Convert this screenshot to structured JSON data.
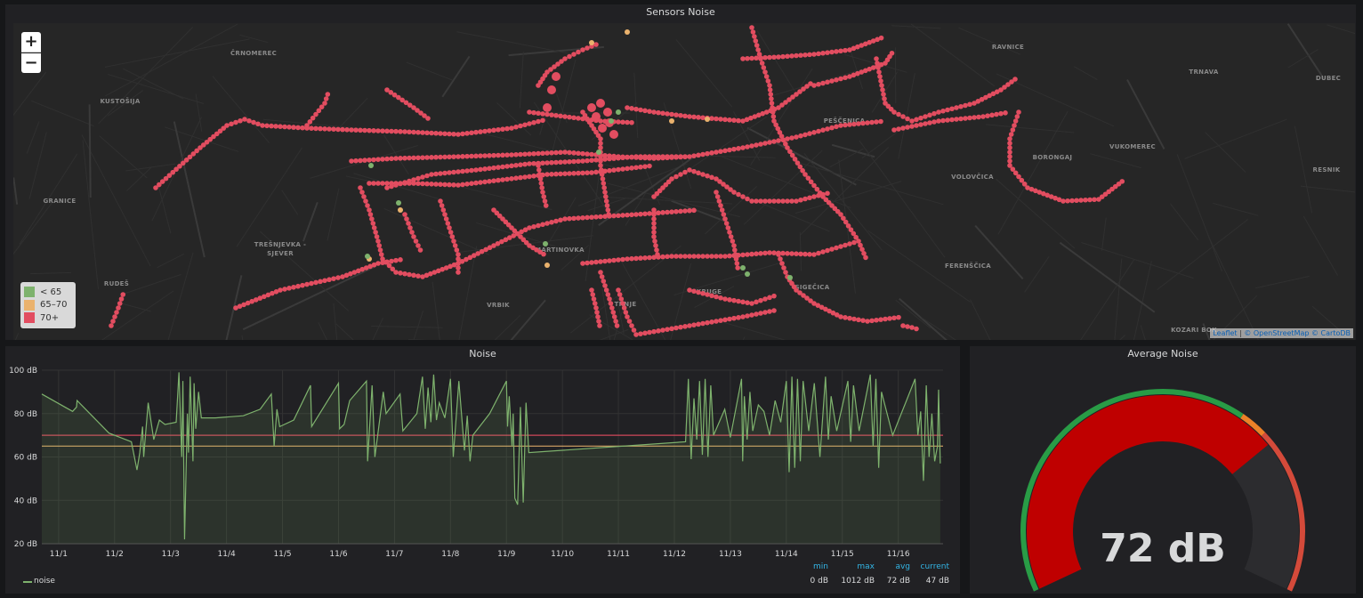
{
  "map_panel": {
    "title": "Sensors Noise",
    "zoom_in": "+",
    "zoom_out": "−",
    "legend": [
      {
        "label": "< 65",
        "color": "#7eb26d"
      },
      {
        "label": "65–70",
        "color": "#eab26d"
      },
      {
        "label": "70+",
        "color": "#e24d60"
      }
    ],
    "attribution": {
      "leaflet": "Leaflet",
      "osm": "© OpenStreetMap",
      "carto": "© CartoDB",
      "sep": " | "
    },
    "place_labels": [
      "ČRNOMEREC",
      "KUSTOŠIJA",
      "GRANICE",
      "TREŠNJEVKA - SJEVER",
      "RUDEŠ",
      "VRBIK",
      "TRNJE",
      "KRUGE",
      "MARTINOVKA",
      "SIGEČICA",
      "FERENŠČICA",
      "PEŠČENICA",
      "VOLOVČICA",
      "BORONGAJ",
      "VUKOMEREC",
      "TRNAVA",
      "RAVNICE",
      "RESNIK",
      "KOZARI BOK",
      "DUBEC"
    ]
  },
  "noise_panel": {
    "title": "Noise",
    "legend": {
      "series": "noise",
      "headers": [
        "min",
        "max",
        "avg",
        "current"
      ],
      "values": [
        "0 dB",
        "1012 dB",
        "72 dB",
        "47 dB"
      ]
    }
  },
  "avg_panel": {
    "title": "Average Noise",
    "value_text": "72 dB"
  },
  "chart_data": {
    "type": "line",
    "title": "Noise",
    "series": [
      {
        "name": "noise",
        "color": "#7eb26d"
      }
    ],
    "x_ticks": [
      "11/1",
      "11/2",
      "11/3",
      "11/4",
      "11/5",
      "11/6",
      "11/7",
      "11/8",
      "11/9",
      "11/10",
      "11/11",
      "11/12",
      "11/13",
      "11/14",
      "11/15",
      "11/16"
    ],
    "y_ticks": [
      "20 dB",
      "40 dB",
      "60 dB",
      "80 dB",
      "100 dB"
    ],
    "ylim": [
      20,
      100
    ],
    "thresholds": [
      {
        "value": 65,
        "color": "#eab26d"
      },
      {
        "value": 70,
        "color": "#e24d60"
      }
    ],
    "grid": true,
    "legend_position": "bottom",
    "points": [
      [
        0.0,
        89
      ],
      [
        0.55,
        81
      ],
      [
        0.62,
        83
      ],
      [
        0.63,
        86
      ],
      [
        1.2,
        71
      ],
      [
        1.4,
        69
      ],
      [
        1.6,
        67
      ],
      [
        1.7,
        54
      ],
      [
        1.75,
        62
      ],
      [
        1.8,
        74
      ],
      [
        1.82,
        60
      ],
      [
        1.9,
        85
      ],
      [
        2.0,
        68
      ],
      [
        2.1,
        77
      ],
      [
        2.2,
        75
      ],
      [
        2.4,
        76
      ],
      [
        2.45,
        99
      ],
      [
        2.5,
        60
      ],
      [
        2.52,
        95
      ],
      [
        2.55,
        22
      ],
      [
        2.6,
        80
      ],
      [
        2.62,
        62
      ],
      [
        2.65,
        97
      ],
      [
        2.7,
        58
      ],
      [
        2.72,
        94
      ],
      [
        2.75,
        73
      ],
      [
        2.8,
        90
      ],
      [
        2.85,
        78
      ],
      [
        3.1,
        78
      ],
      [
        3.6,
        79
      ],
      [
        3.9,
        82
      ],
      [
        4.1,
        89
      ],
      [
        4.15,
        65
      ],
      [
        4.2,
        82
      ],
      [
        4.25,
        74
      ],
      [
        4.5,
        77
      ],
      [
        4.8,
        93
      ],
      [
        4.82,
        74
      ],
      [
        5.3,
        94
      ],
      [
        5.32,
        73
      ],
      [
        5.4,
        75
      ],
      [
        5.5,
        86
      ],
      [
        5.8,
        95
      ],
      [
        5.82,
        58
      ],
      [
        5.9,
        93
      ],
      [
        5.95,
        60
      ],
      [
        6.1,
        90
      ],
      [
        6.15,
        80
      ],
      [
        6.4,
        89
      ],
      [
        6.45,
        72
      ],
      [
        6.7,
        80
      ],
      [
        6.8,
        97
      ],
      [
        6.85,
        73
      ],
      [
        6.9,
        92
      ],
      [
        6.95,
        76
      ],
      [
        7.0,
        98
      ],
      [
        7.05,
        77
      ],
      [
        7.1,
        85
      ],
      [
        7.2,
        78
      ],
      [
        7.3,
        96
      ],
      [
        7.35,
        60
      ],
      [
        7.45,
        95
      ],
      [
        7.55,
        63
      ],
      [
        7.6,
        79
      ],
      [
        7.65,
        58
      ],
      [
        7.7,
        70
      ],
      [
        8.0,
        80
      ],
      [
        8.3,
        95
      ],
      [
        8.32,
        74
      ],
      [
        8.35,
        88
      ],
      [
        8.4,
        65
      ],
      [
        8.42,
        80
      ],
      [
        8.45,
        41
      ],
      [
        8.5,
        38
      ],
      [
        8.55,
        83
      ],
      [
        8.6,
        39
      ],
      [
        8.65,
        85
      ],
      [
        8.7,
        62
      ],
      [
        11.5,
        67
      ],
      [
        11.55,
        96
      ],
      [
        11.6,
        59
      ],
      [
        11.65,
        87
      ],
      [
        11.7,
        68
      ],
      [
        11.75,
        95
      ],
      [
        11.8,
        61
      ],
      [
        11.85,
        96
      ],
      [
        11.9,
        60
      ],
      [
        11.95,
        93
      ],
      [
        12.0,
        70
      ],
      [
        12.2,
        82
      ],
      [
        12.3,
        69
      ],
      [
        12.5,
        96
      ],
      [
        12.52,
        58
      ],
      [
        12.55,
        88
      ],
      [
        12.6,
        68
      ],
      [
        12.65,
        90
      ],
      [
        12.7,
        72
      ],
      [
        12.8,
        84
      ],
      [
        12.9,
        81
      ],
      [
        13.0,
        70
      ],
      [
        13.1,
        86
      ],
      [
        13.2,
        76
      ],
      [
        13.3,
        95
      ],
      [
        13.35,
        53
      ],
      [
        13.4,
        97
      ],
      [
        13.45,
        55
      ],
      [
        13.5,
        96
      ],
      [
        13.55,
        58
      ],
      [
        13.6,
        95
      ],
      [
        13.7,
        72
      ],
      [
        13.8,
        94
      ],
      [
        13.9,
        60
      ],
      [
        14.0,
        97
      ],
      [
        14.05,
        68
      ],
      [
        14.1,
        88
      ],
      [
        14.2,
        72
      ],
      [
        14.4,
        95
      ],
      [
        14.45,
        67
      ],
      [
        14.5,
        93
      ],
      [
        14.6,
        72
      ],
      [
        14.8,
        98
      ],
      [
        14.85,
        65
      ],
      [
        14.9,
        96
      ],
      [
        14.95,
        55
      ],
      [
        15.0,
        90
      ],
      [
        15.2,
        70
      ],
      [
        15.6,
        96
      ],
      [
        15.65,
        70
      ],
      [
        15.7,
        81
      ],
      [
        15.75,
        49
      ],
      [
        15.8,
        93
      ],
      [
        15.85,
        60
      ],
      [
        15.9,
        80
      ],
      [
        15.95,
        58
      ],
      [
        16.0,
        65
      ],
      [
        16.02,
        91
      ],
      [
        16.05,
        57
      ]
    ]
  },
  "gauge": {
    "min": 0,
    "max": 100,
    "value": 72,
    "thresholds": [
      {
        "from": 0,
        "to": 65,
        "color": "#299c46"
      },
      {
        "from": 65,
        "to": 70,
        "color": "#ed8128"
      },
      {
        "from": 70,
        "to": 100,
        "color": "#d44a3a"
      }
    ]
  }
}
